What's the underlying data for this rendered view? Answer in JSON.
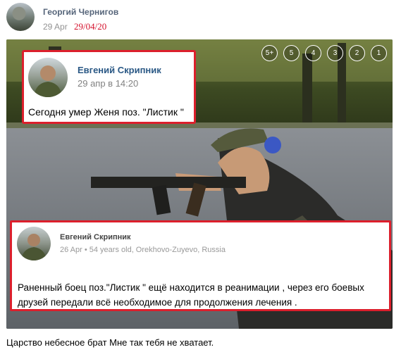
{
  "post": {
    "author": "Георгий Чернигов",
    "date": "29 Apr",
    "date_handwritten": "29/04/20",
    "caption": "Царство небесное брат Мне так тебя не хватает."
  },
  "photo_nav": [
    "5+",
    "5",
    "4",
    "3",
    "2",
    "1"
  ],
  "card_top": {
    "name": "Евгений Скрипник",
    "time": "29 апр в 14:20",
    "text": "Сегодня умер Женя поз. \"Листик \""
  },
  "card_bottom": {
    "name": "Евгений Скрипник",
    "meta": "26 Apr • 54 years old, Orekhovo-Zuyevo, Russia",
    "text": "Раненный боец поз.\"Листик \" ещё находится в реанимации , через его боевых друзей передали всё необходимое для продолжения лечения ."
  },
  "colors": {
    "highlight_border": "#dc1f2c",
    "author_link": "#2a5885",
    "handwritten_date": "#d4102b"
  }
}
